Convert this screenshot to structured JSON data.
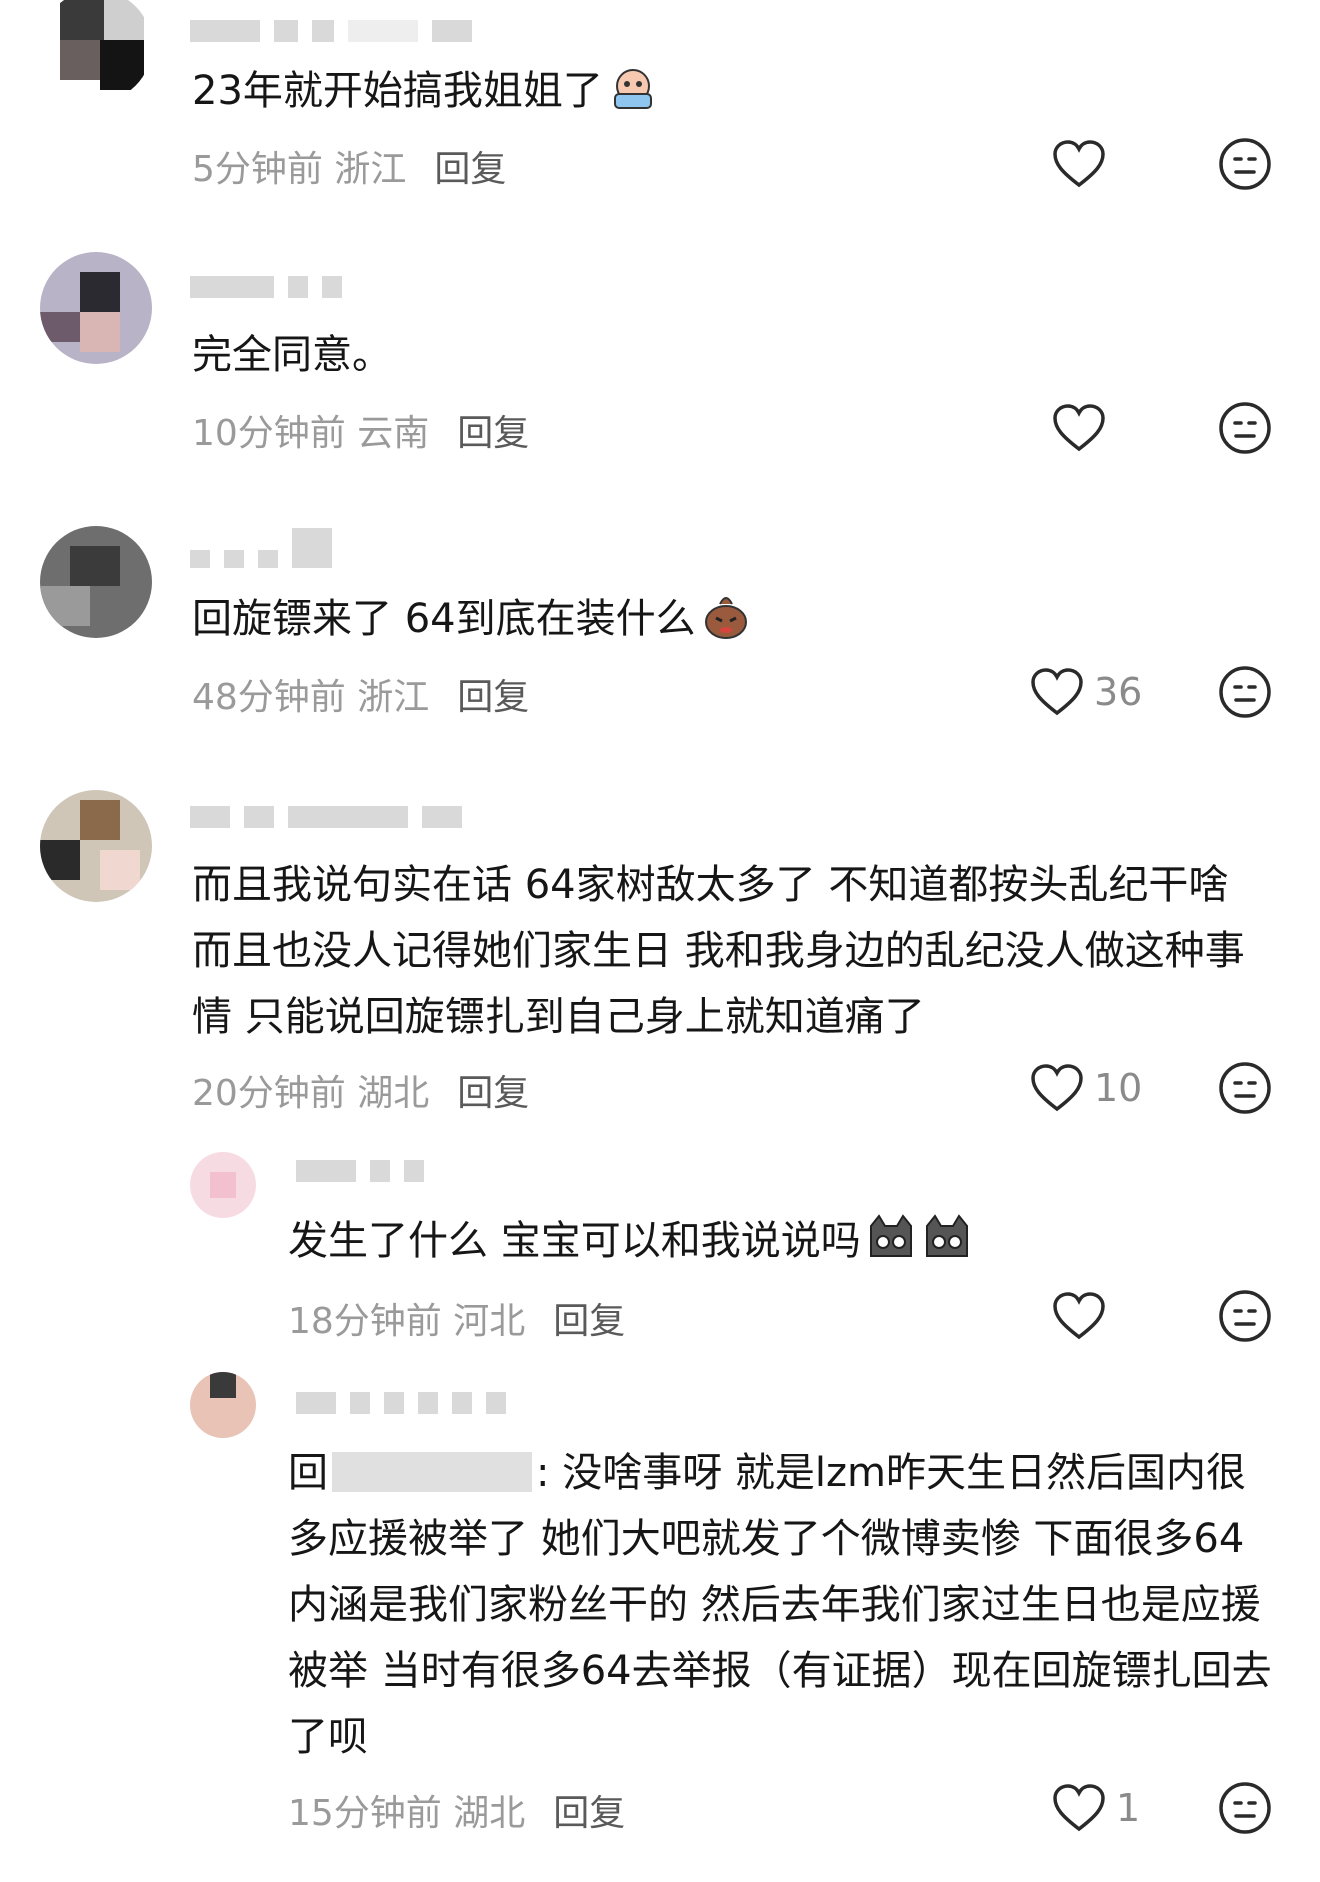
{
  "comments": [
    {
      "text": "23年就开始搞我姐姐了",
      "time": "5分钟前",
      "location": "浙江",
      "reply": "回复",
      "likes": ""
    },
    {
      "text": "完全同意。",
      "time": "10分钟前",
      "location": "云南",
      "reply": "回复",
      "likes": ""
    },
    {
      "text": "回旋镖来了 64到底在装什么",
      "time": "48分钟前",
      "location": "浙江",
      "reply": "回复",
      "likes": "36"
    },
    {
      "text": "而且我说句实在话 64家树敌太多了 不知道都按头乱纪干啥 而且也没人记得她们家生日 我和我身边的乱纪没人做这种事情 只能说回旋镖扎到自己身上就知道痛了",
      "time": "20分钟前",
      "location": "湖北",
      "reply": "回复",
      "likes": "10"
    },
    {
      "text": "发生了什么 宝宝可以和我说说吗",
      "time": "18分钟前",
      "location": "河北",
      "reply": "回复",
      "likes": ""
    },
    {
      "prefix": "回",
      "text": ": 没啥事呀 就是lzm昨天生日然后国内很多应援被举了 她们大吧就发了个微博卖惨 下面很多64内涵是我们家粉丝干的 然后去年我们家过生日也是应援被举 当时有很多64去举报（有证据）现在回旋镖扎回去了呗",
      "time": "15分钟前",
      "location": "湖北",
      "reply": "回复",
      "likes": "1"
    }
  ],
  "icons": {
    "like": "heart-outline-icon",
    "dislike": "meh-face-icon"
  },
  "colors": {
    "text": "#161616",
    "meta": "#9a9a9a",
    "reply": "#5a5a5a",
    "icon": "#2a2a2a"
  }
}
